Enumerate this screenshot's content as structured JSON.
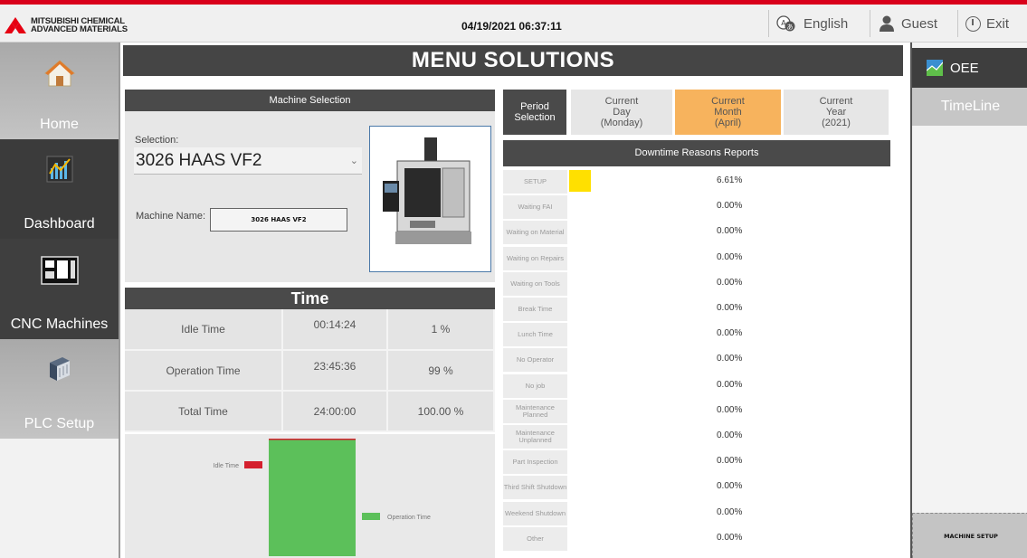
{
  "header": {
    "logo_line1": "MITSUBISHI CHEMICAL",
    "logo_line2": "ADVANCED MATERIALS",
    "datetime": "04/19/2021  06:37:11",
    "language": "English",
    "user": "Guest",
    "exit": "Exit"
  },
  "nav": {
    "items": [
      {
        "label": "Home"
      },
      {
        "label": "Dashboard"
      },
      {
        "label": "CNC Machines"
      },
      {
        "label": "PLC Setup"
      }
    ]
  },
  "title": "MENU SOLUTIONS",
  "machine_selection": {
    "header": "Machine Selection",
    "selection_label": "Selection:",
    "selected": "3026 HAAS VF2",
    "name_label": "Machine Name:",
    "name_value": "3026 HAAS VF2"
  },
  "time": {
    "header": "Time",
    "rows": [
      {
        "label": "Idle Time",
        "value": "00:14:24",
        "pct": "1 %"
      },
      {
        "label": "Operation Time",
        "value": "23:45:36",
        "pct": "99 %"
      },
      {
        "label": "Total Time",
        "value": "24:00:00",
        "pct": "100.00 %"
      }
    ]
  },
  "chart_data": {
    "type": "bar",
    "categories": [
      "Idle Time",
      "Operation Time"
    ],
    "values": [
      1,
      99
    ],
    "legend": [
      "Idle Time",
      "Operation Time"
    ],
    "colors": {
      "Idle Time": "#d4202e",
      "Operation Time": "#5cc05a"
    }
  },
  "period": {
    "label": "Period Selection",
    "options": [
      {
        "line1": "Current",
        "line2": "Day",
        "line3": "(Monday)"
      },
      {
        "line1": "Current",
        "line2": "Month",
        "line3": "(April)"
      },
      {
        "line1": "Current",
        "line2": "Year",
        "line3": "(2021)"
      }
    ],
    "selected": "Current Month (April)",
    "accent": "#f7b35d"
  },
  "downtime": {
    "header": "Downtime Reasons Reports",
    "rows": [
      {
        "label": "SETUP",
        "pct": "6.61%",
        "value": 6.61
      },
      {
        "label": "Waiting FAI",
        "pct": "0.00%",
        "value": 0
      },
      {
        "label": "Waiting on Material",
        "pct": "0.00%",
        "value": 0
      },
      {
        "label": "Waiting on Repairs",
        "pct": "0.00%",
        "value": 0
      },
      {
        "label": "Waiting on Tools",
        "pct": "0.00%",
        "value": 0
      },
      {
        "label": "Break Time",
        "pct": "0.00%",
        "value": 0
      },
      {
        "label": "Lunch Time",
        "pct": "0.00%",
        "value": 0
      },
      {
        "label": "No Operator",
        "pct": "0.00%",
        "value": 0
      },
      {
        "label": "No job",
        "pct": "0.00%",
        "value": 0
      },
      {
        "label": "Maintenance Planned",
        "pct": "0.00%",
        "value": 0
      },
      {
        "label": "Maintenance Unplanned",
        "pct": "0.00%",
        "value": 0
      },
      {
        "label": "Part Inspection",
        "pct": "0.00%",
        "value": 0
      },
      {
        "label": "Third Shift Shutdown",
        "pct": "0.00%",
        "value": 0
      },
      {
        "label": "Weekend Shutdown",
        "pct": "0.00%",
        "value": 0
      },
      {
        "label": "Other",
        "pct": "0.00%",
        "value": 0
      }
    ]
  },
  "right": {
    "oee": "OEE",
    "timeline": "TimeLine",
    "machine_setup": "MACHINE SETUP"
  }
}
